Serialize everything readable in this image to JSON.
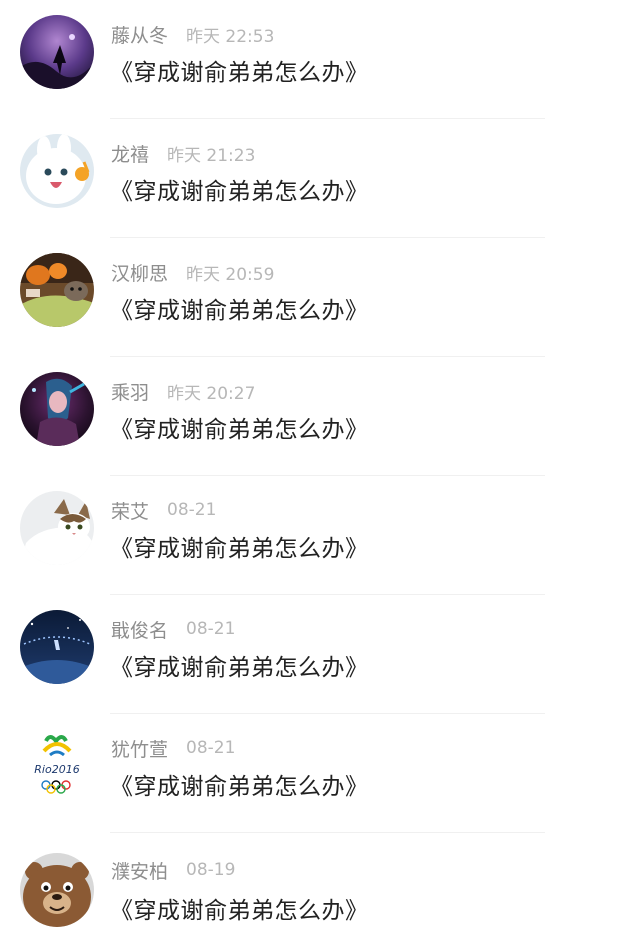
{
  "comments": [
    {
      "name": "藤从冬",
      "time": "昨天 22:53",
      "text": "《穿成谢俞弟弟怎么办》",
      "avatar": "purple-night-avatar"
    },
    {
      "name": "龙禧",
      "time": "昨天 21:23",
      "text": "《穿成谢俞弟弟怎么办》",
      "avatar": "white-rabbit-avatar"
    },
    {
      "name": "汉柳思",
      "time": "昨天 20:59",
      "text": "《穿成谢俞弟弟怎么办》",
      "avatar": "pumpkin-cat-avatar"
    },
    {
      "name": "乘羽",
      "time": "昨天 20:27",
      "text": "《穿成谢俞弟弟怎么办》",
      "avatar": "game-character-avatar"
    },
    {
      "name": "荣艾",
      "time": "08-21",
      "text": "《穿成谢俞弟弟怎么办》",
      "avatar": "cat-avatar"
    },
    {
      "name": "戢俊名",
      "time": "08-21",
      "text": "《穿成谢俞弟弟怎么办》",
      "avatar": "night-castle-avatar"
    },
    {
      "name": "犹竹萱",
      "time": "08-21",
      "text": "《穿成谢俞弟弟怎么办》",
      "avatar": "rio2016-logo-avatar"
    },
    {
      "name": "濮安柏",
      "time": "08-19",
      "text": "《穿成谢俞弟弟怎么办》",
      "avatar": "bear-avatar"
    }
  ]
}
